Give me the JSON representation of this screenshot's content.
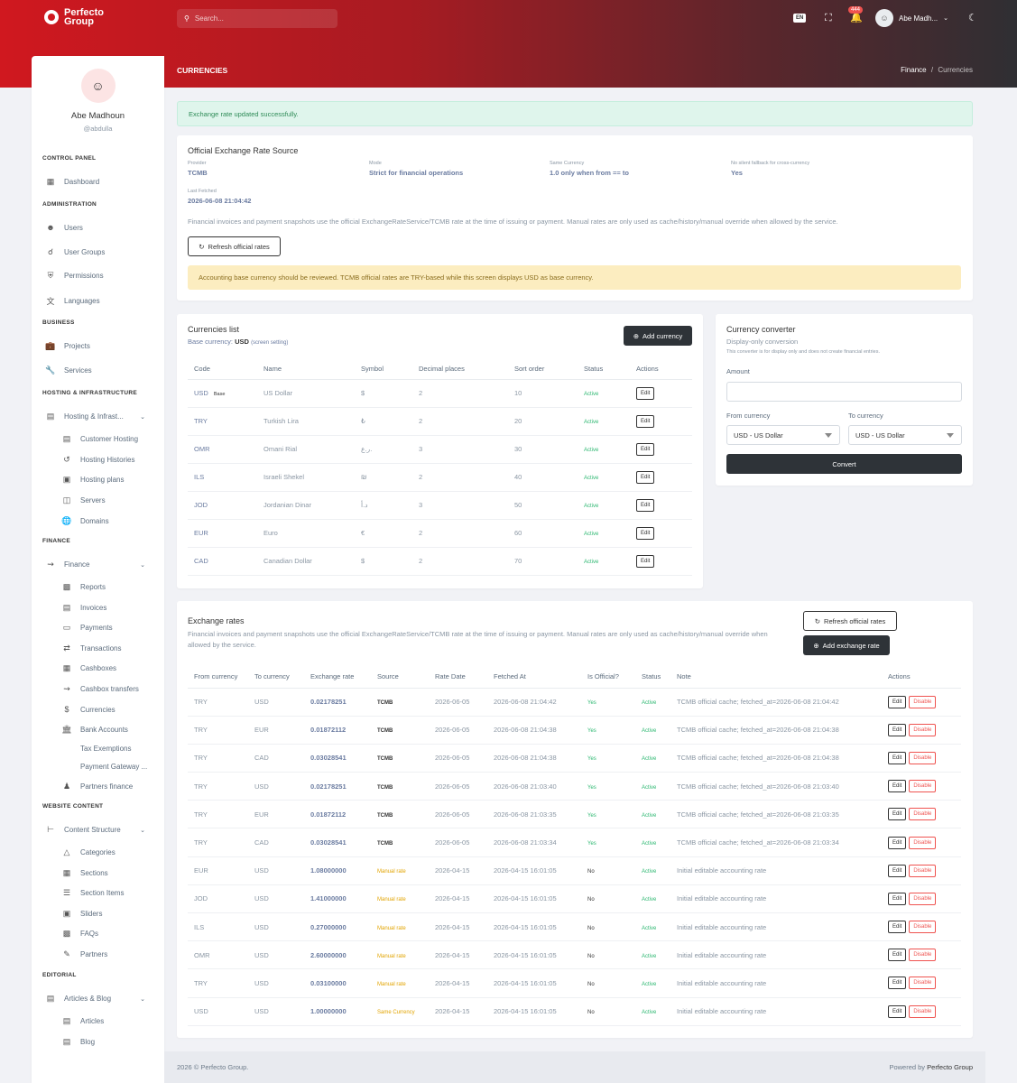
{
  "brand": {
    "name": "Perfecto Group"
  },
  "topbar": {
    "search_placeholder": "Search...",
    "lang": "EN",
    "notif_count": "444",
    "user_name": "Abe Madh..."
  },
  "page": {
    "title": "CURRENCIES",
    "breadcrumb_parent": "Finance",
    "breadcrumb_sep": "/",
    "breadcrumb_current": "Currencies"
  },
  "profile": {
    "name": "Abe Madhoun",
    "username": "@abdulla"
  },
  "sidebar": {
    "sec_control": "CONTROL PANEL",
    "dashboard": "Dashboard",
    "sec_admin": "ADMINISTRATION",
    "users": "Users",
    "user_groups": "User Groups",
    "permissions": "Permissions",
    "languages": "Languages",
    "sec_business": "BUSINESS",
    "projects": "Projects",
    "services": "Services",
    "sec_hosting": "HOSTING & INFRASTRUCTURE",
    "hosting": "Hosting & Infrast...",
    "customer_hosting": "Customer Hosting",
    "hosting_histories": "Hosting Histories",
    "hosting_plans": "Hosting plans",
    "servers": "Servers",
    "domains": "Domains",
    "sec_finance": "FINANCE",
    "finance": "Finance",
    "reports": "Reports",
    "invoices": "Invoices",
    "payments": "Payments",
    "transactions": "Transactions",
    "cashboxes": "Cashboxes",
    "cashbox_transfers": "Cashbox transfers",
    "currencies": "Currencies",
    "bank_accounts": "Bank Accounts",
    "tax_exemptions": "Tax Exemptions",
    "payment_gateway": "Payment Gateway ...",
    "partners_finance": "Partners finance",
    "sec_website": "WEBSITE CONTENT",
    "content_structure": "Content Structure",
    "categories": "Categories",
    "sections": "Sections",
    "section_items": "Section Items",
    "sliders": "Sliders",
    "faqs": "FAQs",
    "partners": "Partners",
    "sec_editorial": "EDITORIAL",
    "articles_blog": "Articles & Blog",
    "articles": "Articles",
    "blog": "Blog"
  },
  "alert_success": "Exchange rate updated successfully.",
  "source": {
    "title": "Official Exchange Rate Source",
    "provider_label": "Provider",
    "provider": "TCMB",
    "mode_label": "Mode",
    "mode": "Strict for financial operations",
    "same_label": "Same Currency",
    "same": "1.0 only when from == to",
    "fallback_label": "No silent fallback for cross-currency",
    "fallback": "Yes",
    "fetched_label": "Last Fetched",
    "fetched": "2026-06-08 21:04:42",
    "desc": "Financial invoices and payment snapshots use the official ExchangeRateService/TCMB rate at the time of issuing or payment. Manual rates are only used as cache/history/manual override when allowed by the service.",
    "refresh_btn": "Refresh official rates",
    "warning": "Accounting base currency should be reviewed. TCMB official rates are TRY-based while this screen displays USD as base currency."
  },
  "currencies": {
    "title": "Currencies list",
    "base_label": "Base currency:",
    "base_value": "USD",
    "base_note": "(screen setting)",
    "add_btn": "Add currency",
    "headers": [
      "Code",
      "Name",
      "Symbol",
      "Decimal places",
      "Sort order",
      "Status",
      "Actions"
    ],
    "base_tag": "Base",
    "edit": "Edit",
    "rows": [
      [
        "USD",
        "US Dollar",
        "$",
        "2",
        "10",
        "Active"
      ],
      [
        "TRY",
        "Turkish Lira",
        "₺",
        "2",
        "20",
        "Active"
      ],
      [
        "OMR",
        "Omani Rial",
        "ر.ع.",
        "3",
        "30",
        "Active"
      ],
      [
        "ILS",
        "Israeli Shekel",
        "₪",
        "2",
        "40",
        "Active"
      ],
      [
        "JOD",
        "Jordanian Dinar",
        "د.أ",
        "3",
        "50",
        "Active"
      ],
      [
        "EUR",
        "Euro",
        "€",
        "2",
        "60",
        "Active"
      ],
      [
        "CAD",
        "Canadian Dollar",
        "$",
        "2",
        "70",
        "Active"
      ]
    ]
  },
  "converter": {
    "title": "Currency converter",
    "subtitle": "Display-only conversion",
    "note": "This converter is for display only and does not create financial entries.",
    "amount_label": "Amount",
    "from_label": "From currency",
    "to_label": "To currency",
    "from_value": "USD - US Dollar",
    "to_value": "USD - US Dollar",
    "convert_btn": "Convert"
  },
  "rates": {
    "title": "Exchange rates",
    "desc": "Financial invoices and payment snapshots use the official ExchangeRateService/TCMB rate at the time of issuing or payment. Manual rates are only used as cache/history/manual override when allowed by the service.",
    "refresh_btn": "Refresh official rates",
    "add_btn": "Add exchange rate",
    "headers": [
      "From currency",
      "To currency",
      "Exchange rate",
      "Source",
      "Rate Date",
      "Fetched At",
      "Is Official?",
      "Status",
      "Note",
      "Actions"
    ],
    "edit": "Edit",
    "disable": "Disable",
    "rows": [
      [
        "TRY",
        "USD",
        "0.02178251",
        "TCMB",
        "2026-06-05",
        "2026-06-08 21:04:42",
        "Yes",
        "Active",
        "TCMB official cache; fetched_at=2026-06-08 21:04:42"
      ],
      [
        "TRY",
        "EUR",
        "0.01872112",
        "TCMB",
        "2026-06-05",
        "2026-06-08 21:04:38",
        "Yes",
        "Active",
        "TCMB official cache; fetched_at=2026-06-08 21:04:38"
      ],
      [
        "TRY",
        "CAD",
        "0.03028541",
        "TCMB",
        "2026-06-05",
        "2026-06-08 21:04:38",
        "Yes",
        "Active",
        "TCMB official cache; fetched_at=2026-06-08 21:04:38"
      ],
      [
        "TRY",
        "USD",
        "0.02178251",
        "TCMB",
        "2026-06-05",
        "2026-06-08 21:03:40",
        "Yes",
        "Active",
        "TCMB official cache; fetched_at=2026-06-08 21:03:40"
      ],
      [
        "TRY",
        "EUR",
        "0.01872112",
        "TCMB",
        "2026-06-05",
        "2026-06-08 21:03:35",
        "Yes",
        "Active",
        "TCMB official cache; fetched_at=2026-06-08 21:03:35"
      ],
      [
        "TRY",
        "CAD",
        "0.03028541",
        "TCMB",
        "2026-06-05",
        "2026-06-08 21:03:34",
        "Yes",
        "Active",
        "TCMB official cache; fetched_at=2026-06-08 21:03:34"
      ],
      [
        "EUR",
        "USD",
        "1.08000000",
        "Manual rate",
        "2026-04-15",
        "2026-04-15 16:01:05",
        "No",
        "Active",
        "Initial editable accounting rate"
      ],
      [
        "JOD",
        "USD",
        "1.41000000",
        "Manual rate",
        "2026-04-15",
        "2026-04-15 16:01:05",
        "No",
        "Active",
        "Initial editable accounting rate"
      ],
      [
        "ILS",
        "USD",
        "0.27000000",
        "Manual rate",
        "2026-04-15",
        "2026-04-15 16:01:05",
        "No",
        "Active",
        "Initial editable accounting rate"
      ],
      [
        "OMR",
        "USD",
        "2.60000000",
        "Manual rate",
        "2026-04-15",
        "2026-04-15 16:01:05",
        "No",
        "Active",
        "Initial editable accounting rate"
      ],
      [
        "TRY",
        "USD",
        "0.03100000",
        "Manual rate",
        "2026-04-15",
        "2026-04-15 16:01:05",
        "No",
        "Active",
        "Initial editable accounting rate"
      ],
      [
        "USD",
        "USD",
        "1.00000000",
        "Same Currency",
        "2026-04-15",
        "2026-04-15 16:01:05",
        "No",
        "Active",
        "Initial editable accounting rate"
      ]
    ]
  },
  "footer": {
    "copyright": "2026 © Perfecto Group.",
    "powered_prefix": "Powered by",
    "powered_name": "Perfecto Group"
  },
  "colors": {
    "brand_red": "#d0181f",
    "dark": "#2e3338",
    "success": "#2eb872",
    "warning": "#e2a400",
    "danger": "#ef5350"
  }
}
